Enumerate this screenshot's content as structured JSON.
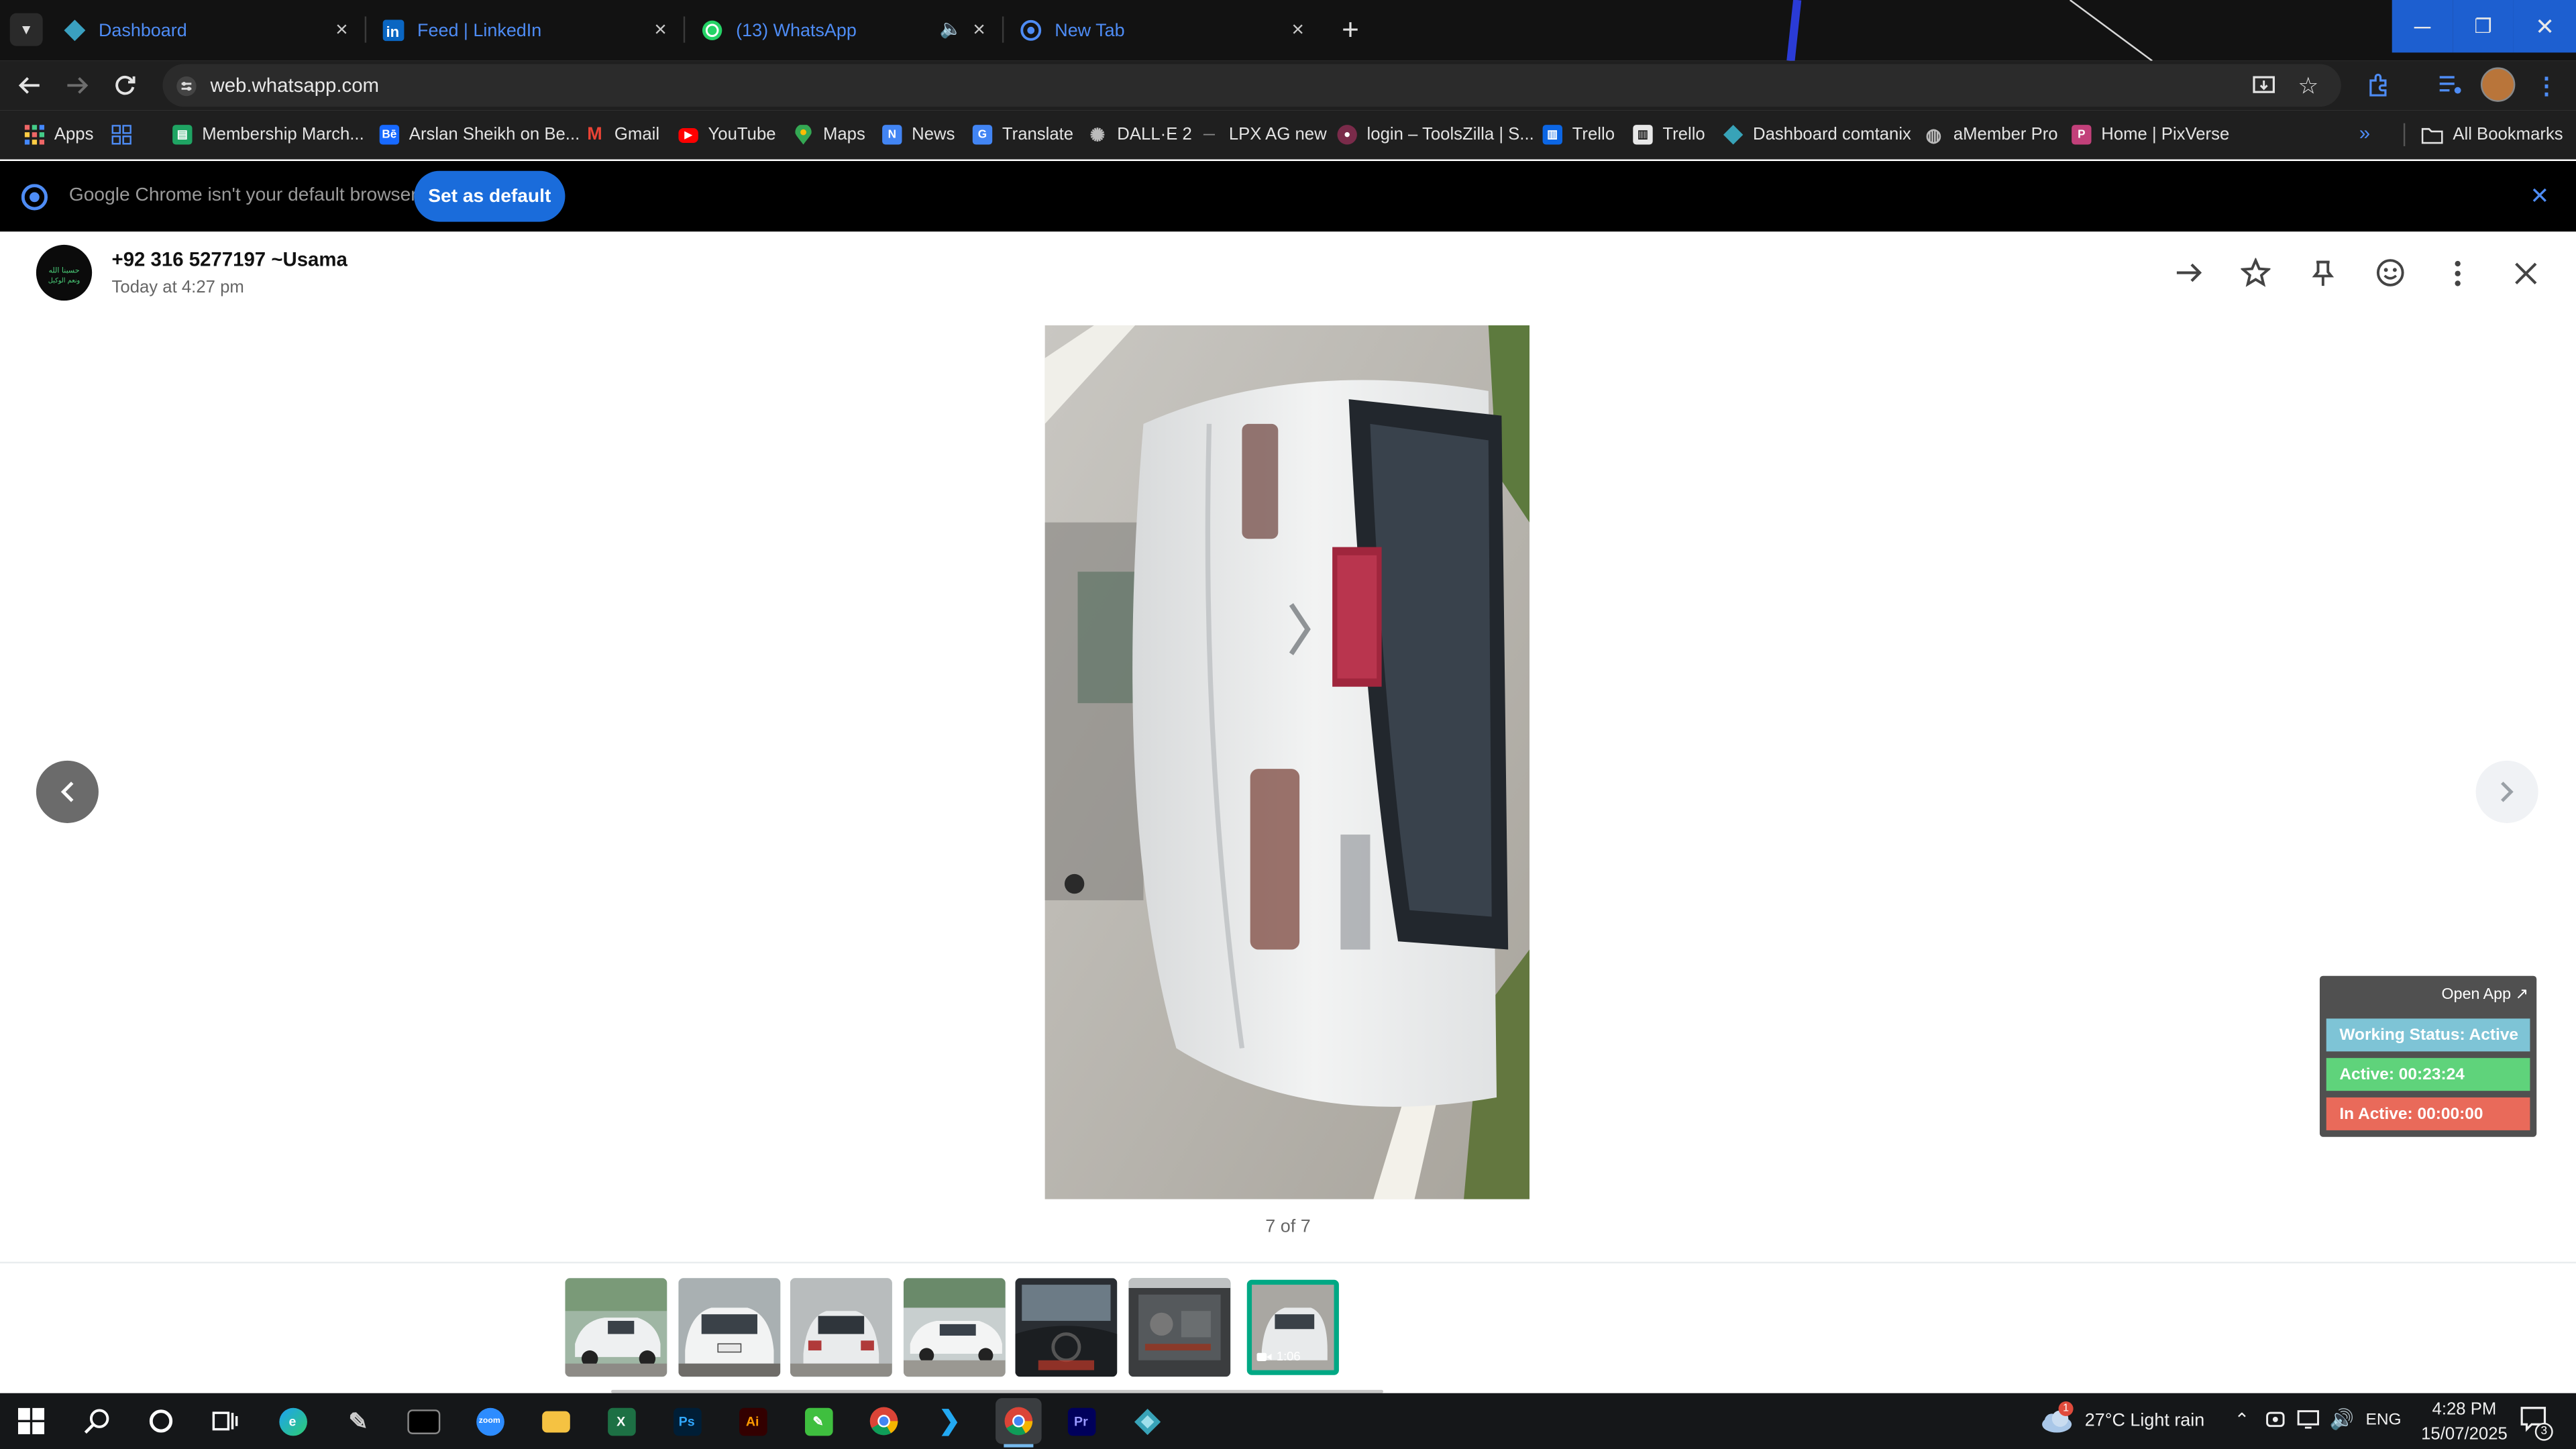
{
  "browser": {
    "tabs": [
      {
        "title": "Dashboard",
        "icon": "dashboard-favicon",
        "active": false
      },
      {
        "title": "Feed | LinkedIn",
        "icon": "linkedin-favicon",
        "active": false
      },
      {
        "title": "(13) WhatsApp",
        "icon": "whatsapp-favicon",
        "active": true,
        "audible": true
      },
      {
        "title": "New Tab",
        "icon": "chrome-favicon",
        "active": false
      }
    ],
    "url": "web.whatsapp.com",
    "bookmarks": [
      {
        "label": "Apps",
        "icon": "apps-grid-icon"
      },
      {
        "label": "Membership March...",
        "icon": "sheets-favicon",
        "color": "#1fa463"
      },
      {
        "label": "Arslan Sheikh on Be...",
        "icon": "behance-favicon",
        "color": "#1769ff"
      },
      {
        "label": "Gmail",
        "icon": "gmail-favicon",
        "color": "#ea4335"
      },
      {
        "label": "YouTube",
        "icon": "youtube-favicon",
        "color": "#ff0000"
      },
      {
        "label": "Maps",
        "icon": "maps-favicon",
        "color": "#34a853"
      },
      {
        "label": "News",
        "icon": "news-favicon",
        "color": "#4285f4"
      },
      {
        "label": "Translate",
        "icon": "translate-favicon",
        "color": "#4285f4"
      },
      {
        "label": "DALL·E 2",
        "icon": "openai-favicon",
        "color": "#8f8f8f"
      },
      {
        "label": "LPX AG new",
        "icon": "dash-favicon",
        "color": "#555555"
      },
      {
        "label": "login – ToolsZilla | S...",
        "icon": "toolszilla-favicon",
        "color": "#7a2b4a"
      },
      {
        "label": "Trello",
        "icon": "trello-favicon",
        "color": "#0c66e4"
      },
      {
        "label": "Trello",
        "icon": "trello-favicon",
        "color": "#e8e8e8"
      },
      {
        "label": "Dashboard comtanix",
        "icon": "dashboard-favicon",
        "color": "#38a3b8"
      },
      {
        "label": "aMember Pro",
        "icon": "amember-favicon",
        "color": "#9a9a9a"
      },
      {
        "label": "Home | PixVerse",
        "icon": "pixverse-favicon",
        "color": "#c2407a"
      }
    ],
    "all_bookmarks": "All Bookmarks",
    "infobar": {
      "message": "Google Chrome isn't your default browser",
      "button": "Set as default"
    }
  },
  "viewer": {
    "sender": "+92 316 5277197 ~Usama",
    "timestamp": "Today at 4:27 pm",
    "counter": "7 of 7",
    "thumbnails": [
      {
        "kind": "image"
      },
      {
        "kind": "image"
      },
      {
        "kind": "image"
      },
      {
        "kind": "image"
      },
      {
        "kind": "image"
      },
      {
        "kind": "image"
      },
      {
        "kind": "video",
        "duration": "1:06",
        "selected": true
      }
    ],
    "accent": "#00a884"
  },
  "widget": {
    "open_app": "Open App ↗",
    "working_status": "Working Status: Active",
    "active": "Active: 00:23:24",
    "inactive": "In Active: 00:00:00",
    "colors": {
      "status": "#7ec4d6",
      "active": "#5fd37b",
      "inactive": "#e96a5a"
    }
  },
  "taskbar": {
    "weather": "27°C  Light rain",
    "weather_badge": "1",
    "language": "ENG",
    "time": "4:28 PM",
    "date": "15/07/2025",
    "notifications": "3"
  }
}
